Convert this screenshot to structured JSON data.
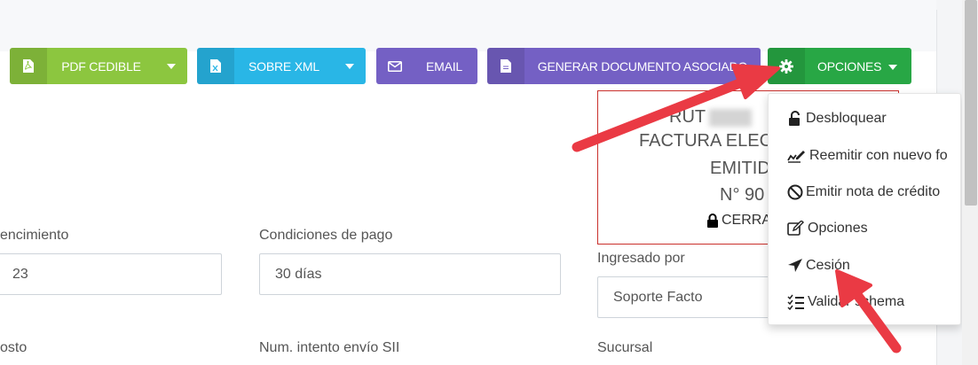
{
  "toolbar": {
    "pdf_label": "PDF CEDIBLE",
    "xml_label": "SOBRE XML",
    "email_label": "EMAIL",
    "generate_label": "GENERAR DOCUMENTO ASOCIADO",
    "options_label": "OPCIONES"
  },
  "document": {
    "rut_prefix": "RUT",
    "type_line": "FACTURA ELEC",
    "status_line": "EMITID",
    "number_line": "N° 90",
    "closed_label": "CERRA"
  },
  "fields": {
    "due_label": "encimiento",
    "due_value": "23",
    "terms_label": "Condiciones de pago",
    "terms_value": "30 días",
    "entered_by_label": "Ingresado por",
    "entered_by_value": "Soporte Facto",
    "cost_label": "osto",
    "sii_attempt_label": "Num. intento envío SII",
    "branch_label": "Sucursal"
  },
  "menu": {
    "items": [
      {
        "label": "Desbloquear",
        "icon": "unlock-icon"
      },
      {
        "label": "Reemitir con nuevo fo",
        "icon": "sign-icon"
      },
      {
        "label": "Emitir nota de crédito",
        "icon": "ban-icon"
      },
      {
        "label": "Opciones",
        "icon": "edit-icon"
      },
      {
        "label": "Cesión",
        "icon": "location-arrow-icon"
      },
      {
        "label": "Validar schema",
        "icon": "tasks-icon"
      }
    ]
  },
  "colors": {
    "pdf": "#8cc63f",
    "xml": "#29b6e6",
    "email": "#7460c4",
    "generate": "#7460c4",
    "options": "#28a745",
    "annotation_arrow": "#ea3a44",
    "doc_border": "#c9302c"
  }
}
